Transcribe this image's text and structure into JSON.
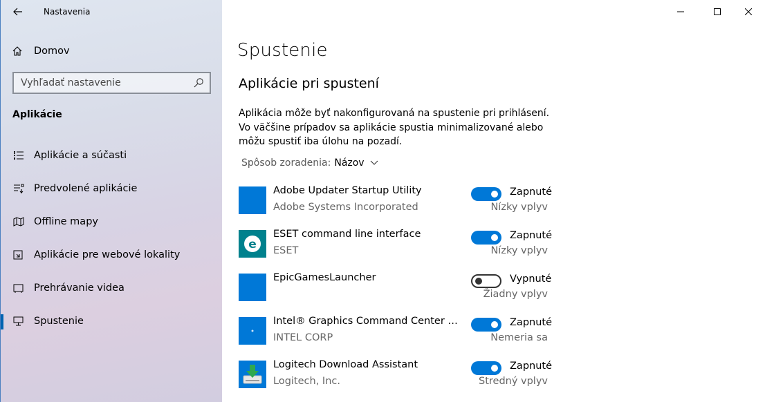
{
  "window": {
    "title": "Nastavenia"
  },
  "sidebar": {
    "home_label": "Domov",
    "search_placeholder": "Vyhľadať nastavenie",
    "section_title": "Aplikácie",
    "items": [
      {
        "label": "Aplikácie a súčasti",
        "icon": "apps-list-icon",
        "active": false
      },
      {
        "label": "Predvolené aplikácie",
        "icon": "default-apps-icon",
        "active": false
      },
      {
        "label": "Offline mapy",
        "icon": "map-icon",
        "active": false
      },
      {
        "label": "Aplikácie pre webové lokality",
        "icon": "web-apps-icon",
        "active": false
      },
      {
        "label": "Prehrávanie videa",
        "icon": "video-icon",
        "active": false
      },
      {
        "label": "Spustenie",
        "icon": "startup-icon",
        "active": true
      }
    ]
  },
  "main": {
    "title": "Spustenie",
    "subsection": "Aplikácie pri spustení",
    "description": "Aplikácia môže byť nakonfigurovaná na spustenie pri prihlásení. Vo väčšine prípadov sa aplikácie spustia minimalizované alebo môžu spustiť iba úlohu na pozadí.",
    "sort_label": "Spôsob zoradenia:",
    "sort_value": "Názov",
    "apps": [
      {
        "name": "Adobe Updater Startup Utility",
        "publisher": "Adobe Systems Incorporated",
        "state": "Zapnuté",
        "enabled": true,
        "impact": "Nízky vplyv",
        "icon": "blank-app-icon"
      },
      {
        "name": "ESET command line interface",
        "publisher": "ESET",
        "state": "Zapnuté",
        "enabled": true,
        "impact": "Nízky vplyv",
        "icon": "eset-icon"
      },
      {
        "name": "EpicGamesLauncher",
        "publisher": "",
        "state": "Vypnuté",
        "enabled": false,
        "impact": "Žiadny vplyv",
        "icon": "blank-app-icon"
      },
      {
        "name": "Intel® Graphics Command Center Start...",
        "publisher": "INTEL CORP",
        "state": "Zapnuté",
        "enabled": true,
        "impact": "Nemeria sa",
        "icon": "intel-icon"
      },
      {
        "name": "Logitech Download Assistant",
        "publisher": "Logitech, Inc.",
        "state": "Zapnuté",
        "enabled": true,
        "impact": "Stredný vplyv",
        "icon": "logitech-download-icon"
      }
    ]
  },
  "colors": {
    "accent": "#0078d7",
    "active_bar": "#0063b1"
  }
}
